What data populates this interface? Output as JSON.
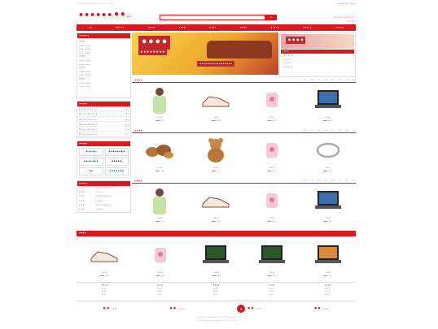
{
  "topbar": {
    "left": "••••••••••••••••••••••••••••",
    "right": "••••••••• ••••"
  },
  "logo": {
    "part1": "••••••",
    "part2": "••",
    "part3": "••"
  },
  "search": {
    "placeholder": "•••••••",
    "button": "••",
    "hot": "•••••• ••• ••••• ••• ••••• ••••• ••••• •••••"
  },
  "contact": {
    "line1": "•••••• ••••••••",
    "line2": "•••••"
  },
  "nav": [
    "••",
    "•••••",
    "••••",
    "••••",
    "••••",
    "••••",
    "•••••",
    "•••••",
    "•••••"
  ],
  "categories": {
    "title": "••••••",
    "lines": [
      "••••",
      "••••  ••••",
      "••••  ••••",
      "••••  ••••",
      "••••",
      "••••  ••••",
      "••••  ••••",
      "••••",
      "••••  ••••",
      "••••  ••••",
      "••••",
      "••••  ••••",
      "••••  ••••"
    ]
  },
  "rank": {
    "title": "•••••",
    "items": [
      {
        "n": "1.••••••••••••",
        "p": "•••"
      },
      {
        "n": "2.••••••••••••",
        "p": "•••"
      },
      {
        "n": "3.••••••••••••",
        "p": "•••"
      },
      {
        "n": "4.••••••••••••",
        "p": "•••"
      },
      {
        "n": "5.••••••••••••",
        "p": "•••"
      },
      {
        "n": "6.••••••••••••",
        "p": "•••"
      }
    ]
  },
  "brands": {
    "title": "•••••",
    "items": [
      "•••••",
      "••••••••",
      "•••••••",
      "•••••",
      "••",
      "•••••••"
    ]
  },
  "orders": {
    "title": "•••••",
    "items": [
      {
        "k": "•••••",
        "v": "•••••••••••••"
      },
      {
        "k": "•••••",
        "v": "•••••"
      },
      {
        "k": "•••••",
        "v": "•••••••••••••"
      },
      {
        "k": "•••••",
        "v": "••••••"
      },
      {
        "k": "•••••",
        "v": "•••••••••••••"
      },
      {
        "k": "•••••",
        "v": "••••••"
      }
    ]
  },
  "banner": {
    "title": "••••",
    "sub": "••••••••",
    "promo": "•••••••••••••••••"
  },
  "sidead": {
    "img": "••••",
    "title": "••••",
    "items": [
      "••••••••",
      "••••••",
      "••••••",
      "••••••••"
    ]
  },
  "colors": {
    "brand": "#d71920"
  },
  "sections": [
    {
      "name": "••••",
      "tabs": [
        "•••",
        "•••",
        "•••",
        "•••",
        "•••",
        "•••",
        "•••",
        "•••"
      ],
      "products": [
        {
          "name": "••••",
          "price": "•••",
          "old": "•••"
        },
        {
          "name": "••••",
          "price": "•••",
          "old": "•••"
        },
        {
          "name": "••••",
          "price": "•••",
          "old": "•••"
        },
        {
          "name": "••••",
          "price": "•••",
          "old": "•••"
        }
      ]
    },
    {
      "name": "••••",
      "tabs": [
        "•••",
        "•••",
        "•••",
        "•••",
        "•••",
        "•••",
        "•••",
        "•••"
      ],
      "products": [
        {
          "name": "••••",
          "price": "•••",
          "old": "•••"
        },
        {
          "name": "••••",
          "price": "•••",
          "old": "•••"
        },
        {
          "name": "••••",
          "price": "•••",
          "old": "•••"
        },
        {
          "name": "••••",
          "price": "•••",
          "old": "•••"
        }
      ]
    },
    {
      "name": "••••",
      "tabs": [
        "•••",
        "•••",
        "•••",
        "•••",
        "•••",
        "•••",
        "•••",
        "•••"
      ],
      "products": [
        {
          "name": "••••",
          "price": "•••",
          "old": "•••"
        },
        {
          "name": "••••",
          "price": "•••",
          "old": "•••"
        },
        {
          "name": "••••",
          "price": "•••",
          "old": "•••"
        },
        {
          "name": "••••",
          "price": "•••",
          "old": "•••"
        }
      ]
    }
  ],
  "bottom": {
    "title": "••••",
    "products": [
      {
        "name": "••••",
        "price": "•••",
        "old": "•••"
      },
      {
        "name": "••••",
        "price": "•••",
        "old": "•••"
      },
      {
        "name": "••••",
        "price": "•••",
        "old": "•••"
      },
      {
        "name": "••••",
        "price": "•••",
        "old": "•••"
      },
      {
        "name": "••••",
        "price": "•••",
        "old": "•••"
      }
    ]
  },
  "help": [
    {
      "t": "••••",
      "items": [
        "••••",
        "••••",
        "••••"
      ]
    },
    {
      "t": "••••",
      "items": [
        "••••",
        "••••",
        "••••"
      ]
    },
    {
      "t": "••••",
      "items": [
        "••••",
        "••••",
        "••••"
      ]
    },
    {
      "t": "••••",
      "items": [
        "••••",
        "••••",
        "••••"
      ]
    },
    {
      "t": "••••",
      "items": [
        "••••",
        "••••",
        "••••"
      ]
    }
  ],
  "service": [
    {
      "big": "••",
      "txt": "••••"
    },
    {
      "big": "••",
      "txt": "•••••"
    },
    {
      "big": "••",
      "txt": "••••"
    },
    {
      "big": "••",
      "txt": "•••••"
    }
  ],
  "footer": {
    "line1": "•••••••• ••••••••••••••••••••••••",
    "line2": "•••••••••••••••••••••••••••••••••"
  }
}
